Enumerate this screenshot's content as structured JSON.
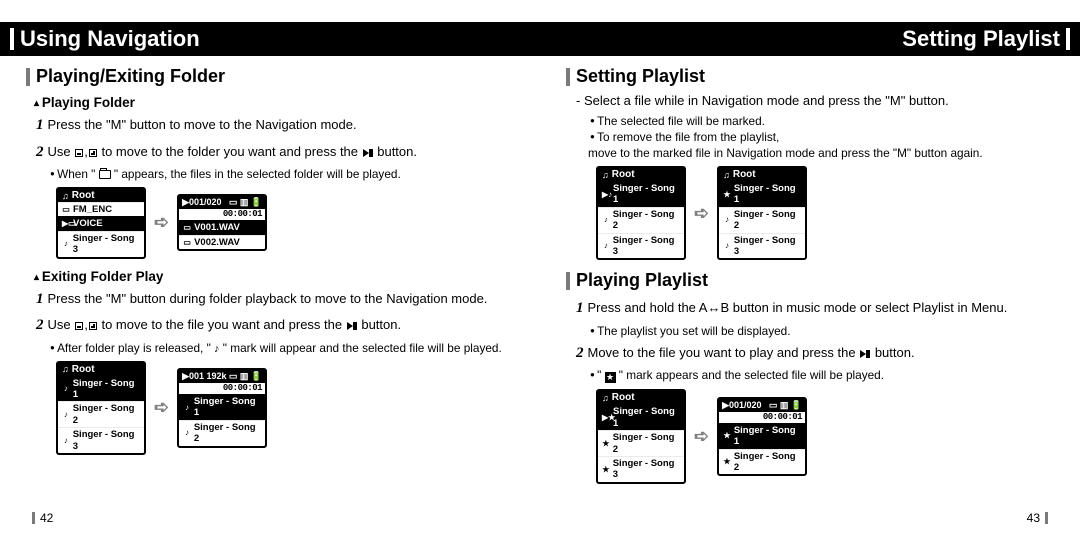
{
  "left": {
    "title": "Using Navigation",
    "section1": {
      "heading": "Playing/Exiting Folder",
      "sub1": {
        "heading": "Playing Folder",
        "step1": "Press the \"M\" button to move to the Navigation mode.",
        "step2_a": "Use ",
        "step2_b": " to move to the folder you want and press the ",
        "step2_c": " button.",
        "bullet": "When \" ",
        "bullet_b": " \" appears, the files in the selected folder will be played.",
        "lcd1": {
          "title": "Root",
          "rows": [
            "FM_ENC",
            "VOICE",
            "Singer - Song 3"
          ]
        },
        "lcd2": {
          "status": "001/020",
          "timer": "00:00:01",
          "rows": [
            "V001.WAV",
            "V002.WAV"
          ]
        }
      },
      "sub2": {
        "heading": "Exiting Folder Play",
        "step1": "Press the \"M\" button during folder playback to move to the Navigation mode.",
        "step2_a": "Use ",
        "step2_b": " to move to the file you want and press the ",
        "step2_c": " button.",
        "bullet": "After folder play is released, \" ",
        "bullet_b": " \" mark will appear and the selected file will be played.",
        "lcd1": {
          "title": "Root",
          "rows": [
            "Singer - Song 1",
            "Singer - Song 2",
            "Singer - Song 3"
          ]
        },
        "lcd2": {
          "status": "001 192k",
          "timer": "00:00:01",
          "rows": [
            "Singer - Song 1",
            "Singer - Song 2"
          ]
        }
      }
    },
    "pagenum": "42"
  },
  "right": {
    "title": "Setting Playlist",
    "section1": {
      "heading": "Setting Playlist",
      "dash": "- Select a file while in Navigation mode and press the \"M\" button.",
      "b1": "The selected file will be marked.",
      "b2": "To remove the file from the playlist,",
      "b2c": "move to the marked file in Navigation mode and press the \"M\" button again.",
      "lcd1": {
        "title": "Root",
        "rows": [
          "Singer - Song 1",
          "Singer - Song 2",
          "Singer - Song 3"
        ]
      },
      "lcd2": {
        "title": "Root",
        "rows": [
          "Singer - Song 1",
          "Singer - Song 2",
          "Singer - Song 3"
        ]
      }
    },
    "section2": {
      "heading": "Playing Playlist",
      "step1": "Press and hold the A↔B button in music mode or select Playlist in Menu.",
      "b1": "The playlist you set will be displayed.",
      "step2_a": "Move to the file you want to play and press the ",
      "step2_b": " button.",
      "b2_a": "\" ",
      "b2_b": " \" mark appears and the selected file will be played.",
      "lcd1": {
        "title": "Root",
        "rows": [
          "Singer - Song 1",
          "Singer - Song 2",
          "Singer - Song 3"
        ]
      },
      "lcd2": {
        "status": "001/020",
        "timer": "00:00:01",
        "rows": [
          "Singer - Song 1",
          "Singer - Song 2"
        ]
      }
    },
    "pagenum": "43"
  }
}
